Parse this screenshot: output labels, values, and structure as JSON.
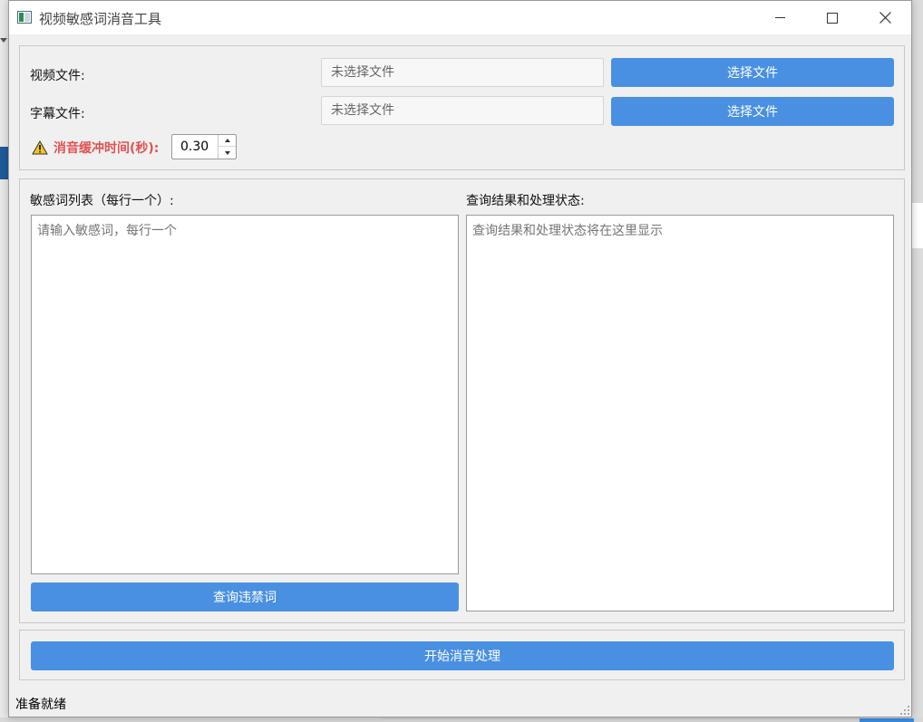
{
  "window": {
    "title": "视频敏感词消音工具",
    "icons": {
      "app": "app-icon",
      "minimize": "minimize-icon",
      "maximize": "maximize-icon",
      "close": "close-icon"
    }
  },
  "files": {
    "video_label": "视频文件:",
    "video_value": "未选择文件",
    "video_button": "选择文件",
    "subtitle_label": "字幕文件:",
    "subtitle_value": "未选择文件",
    "subtitle_button": "选择文件"
  },
  "buffer": {
    "label": "消音缓冲时间(秒):",
    "value": "0.30",
    "icon": "warning-icon"
  },
  "words": {
    "label": "敏感词列表（每行一个）:",
    "placeholder": "请输入敏感词，每行一个",
    "query_button": "查询违禁词"
  },
  "results": {
    "label": "查询结果和处理状态:",
    "placeholder": "查询结果和处理状态将在这里显示"
  },
  "actions": {
    "start_button": "开始消音处理"
  },
  "status": {
    "text": "准备就绪"
  },
  "colors": {
    "accent": "#4a90e2",
    "warning": "#e05252",
    "background": "#f0f0f0"
  }
}
